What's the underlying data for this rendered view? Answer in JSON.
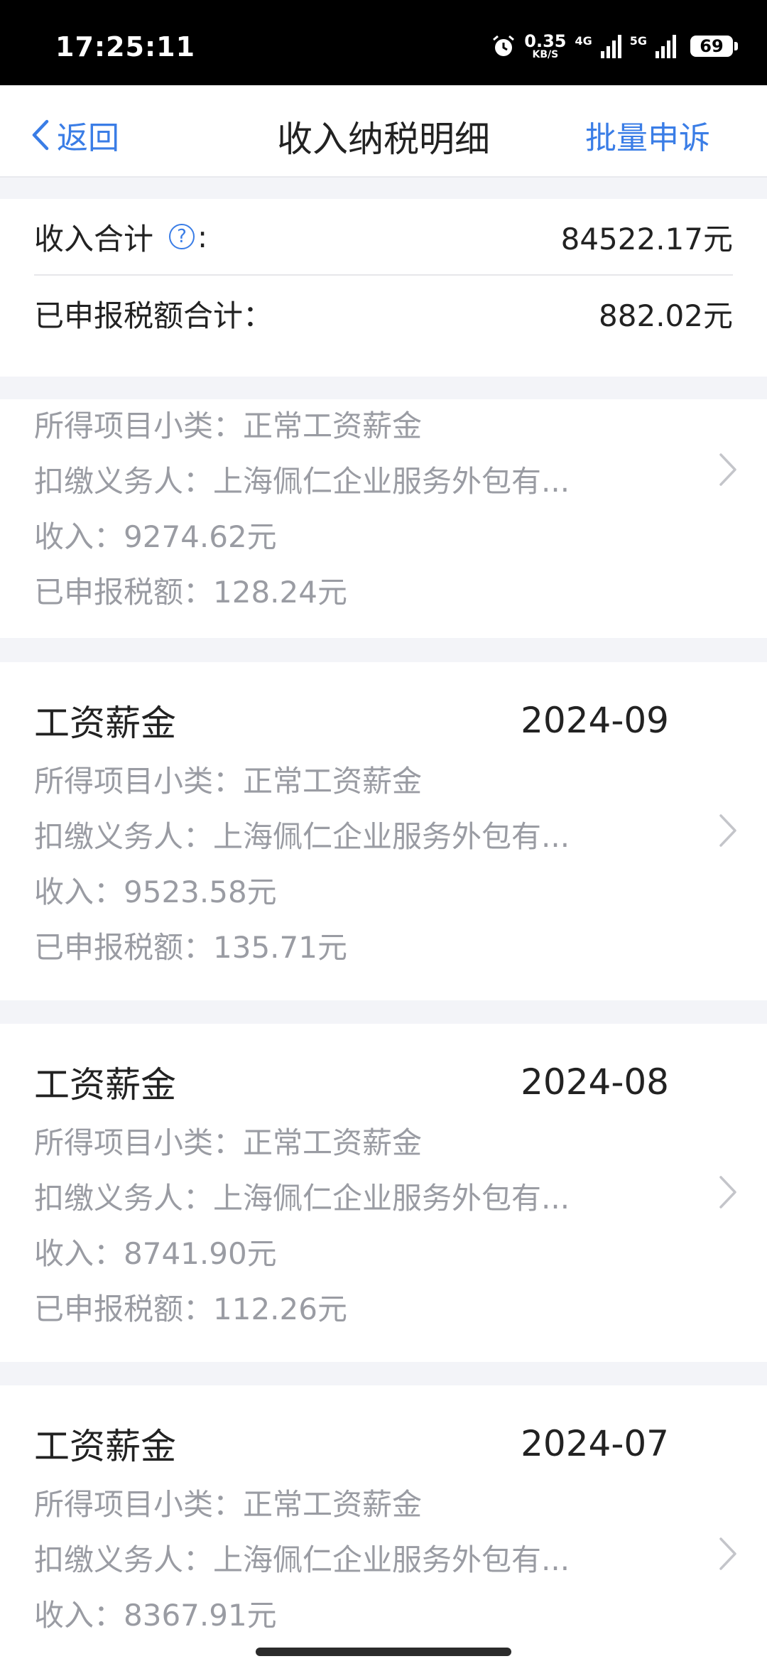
{
  "status_bar": {
    "time": "17:25:11",
    "net_speed": "0.35",
    "net_speed_unit": "KB/S",
    "net1": "4G",
    "net2": "5G",
    "battery": "69"
  },
  "nav": {
    "back_label": "返回",
    "title": "收入纳税明细",
    "action_label": "批量申诉"
  },
  "summary": {
    "income_label": "收入合计",
    "income_value": "84522.17元",
    "tax_label": "已申报税额合计：",
    "tax_value": "882.02元"
  },
  "records": [
    {
      "title": "",
      "period": "",
      "subcategory": "所得项目小类：正常工资薪金",
      "payer": "扣缴义务人：上海佩仁企业服务外包有...",
      "income": "收入：9274.62元",
      "tax": "已申报税额：128.24元"
    },
    {
      "title": "工资薪金",
      "period": "2024-09",
      "subcategory": "所得项目小类：正常工资薪金",
      "payer": "扣缴义务人：上海佩仁企业服务外包有...",
      "income": "收入：9523.58元",
      "tax": "已申报税额：135.71元"
    },
    {
      "title": "工资薪金",
      "period": "2024-08",
      "subcategory": "所得项目小类：正常工资薪金",
      "payer": "扣缴义务人：上海佩仁企业服务外包有...",
      "income": "收入：8741.90元",
      "tax": "已申报税额：112.26元"
    },
    {
      "title": "工资薪金",
      "period": "2024-07",
      "subcategory": "所得项目小类：正常工资薪金",
      "payer": "扣缴义务人：上海佩仁企业服务外包有...",
      "income": "收入：8367.91元",
      "tax": ""
    }
  ],
  "colors": {
    "accent": "#3a7de6",
    "muted_text": "#9a9ca3",
    "page_bg": "#f3f4f8"
  }
}
